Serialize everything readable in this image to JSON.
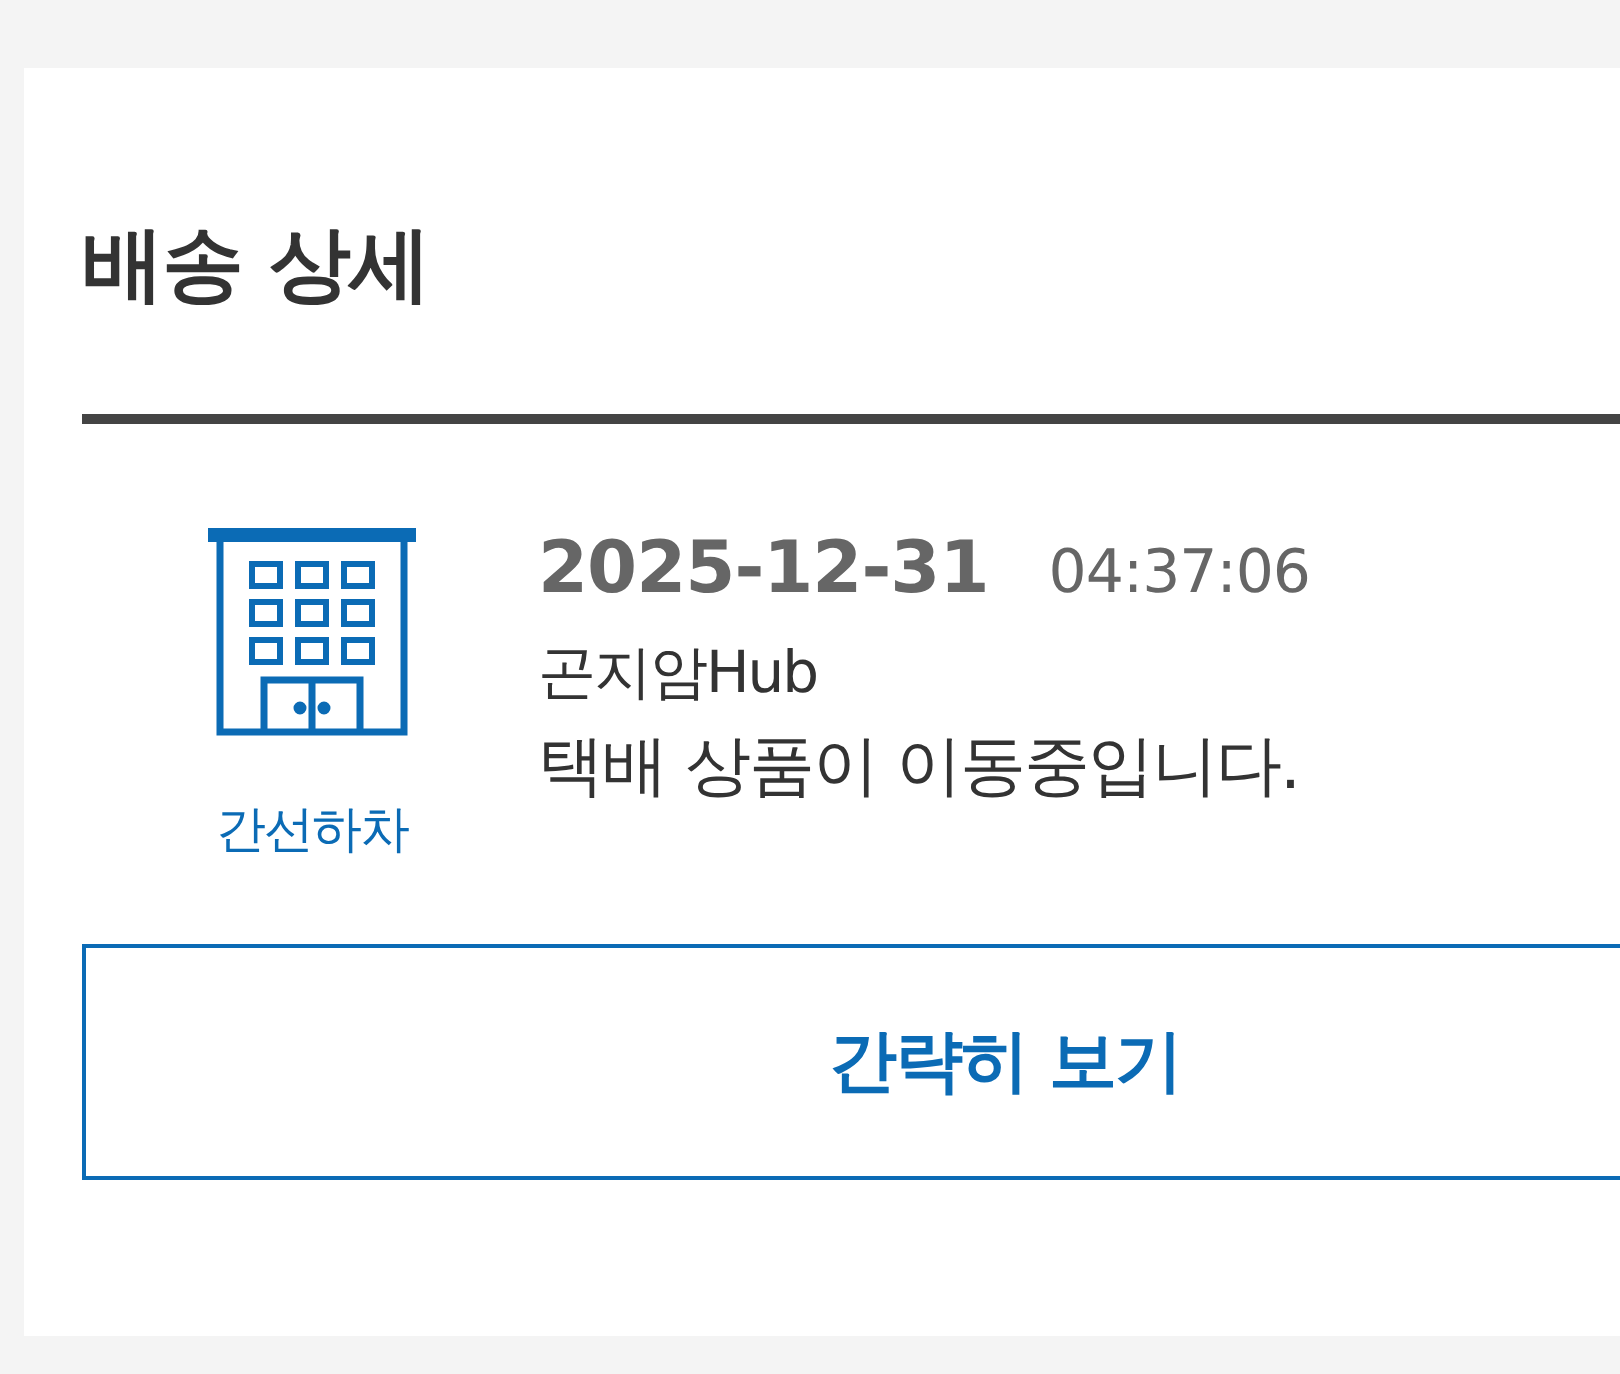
{
  "title": "배송 상세",
  "events": [
    {
      "status": "간선하차",
      "date": "2025-12-31",
      "time": "04:37:06",
      "location": "곤지암Hub",
      "message": "택배 상품이 이동중입니다."
    }
  ],
  "button": {
    "label": "간략히 보기"
  }
}
